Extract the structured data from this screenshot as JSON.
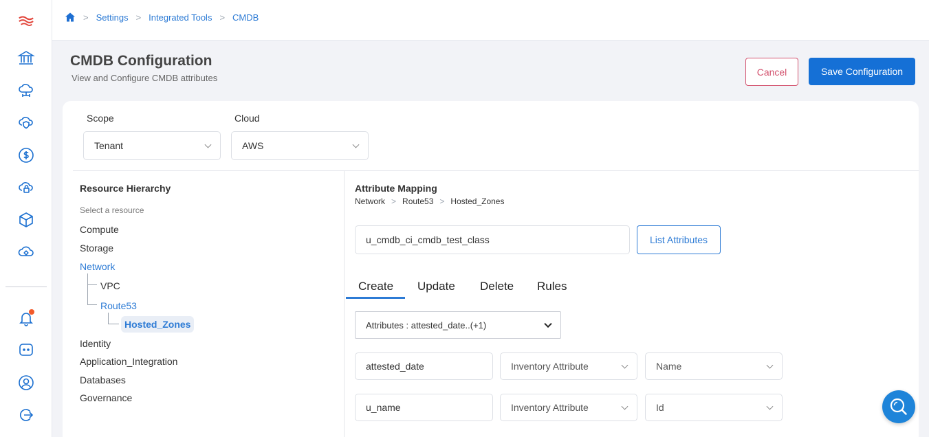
{
  "breadcrumb": {
    "items": [
      "Settings",
      "Integrated Tools",
      "CMDB"
    ]
  },
  "page": {
    "title": "CMDB Configuration",
    "subtitle": "View and Configure CMDB attributes",
    "cancel_label": "Cancel",
    "save_label": "Save Configuration"
  },
  "filters": {
    "scope_label": "Scope",
    "scope_value": "Tenant",
    "cloud_label": "Cloud",
    "cloud_value": "AWS"
  },
  "hierarchy": {
    "title": "Resource Hierarchy",
    "hint": "Select a resource",
    "items": {
      "compute": "Compute",
      "storage": "Storage",
      "network": "Network",
      "vpc": "VPC",
      "route53": "Route53",
      "hosted_zones": "Hosted_Zones",
      "identity": "Identity",
      "application_integration": "Application_Integration",
      "databases": "Databases",
      "governance": "Governance"
    }
  },
  "mapping": {
    "title": "Attribute Mapping",
    "path": [
      "Network",
      "Route53",
      "Hosted_Zones"
    ],
    "class_value": "u_cmdb_ci_cmdb_test_class",
    "list_label": "List Attributes",
    "tabs": [
      "Create",
      "Update",
      "Delete",
      "Rules"
    ],
    "active_tab": "Create",
    "attributes_select": "Attributes : attested_date..(+1)",
    "rows": [
      {
        "field": "attested_date",
        "source": "Inventory Attribute",
        "target": "Name"
      },
      {
        "field": "u_name",
        "source": "Inventory Attribute",
        "target": "Id"
      }
    ]
  },
  "colors": {
    "primary": "#1570d6",
    "link": "#2d7bd5",
    "cancel": "#d3526e",
    "notification": "#f25a2a"
  },
  "icons": {
    "sidebar": [
      "logo-icon",
      "bank-icon",
      "cloud-network-icon",
      "cloud-shield-icon",
      "dollar-icon",
      "cloud-lock-icon",
      "cube-icon",
      "cloud-gear-icon",
      "bell-icon",
      "chat-icon",
      "user-icon",
      "logout-icon"
    ],
    "fab": "search-icon"
  }
}
